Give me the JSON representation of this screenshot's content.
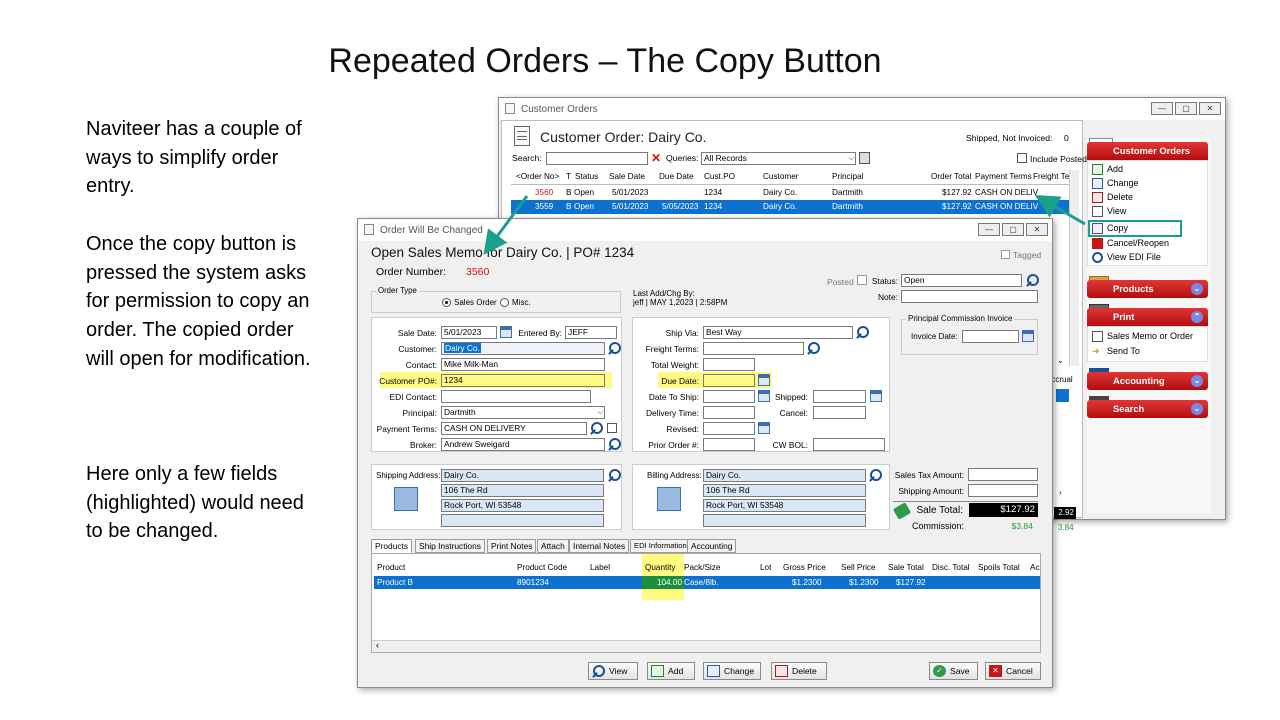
{
  "slide": {
    "title": "Repeated Orders – The Copy Button",
    "paragraphs": [
      "Naviteer has a couple of ways to simplify order entry.",
      "Once the copy button is pressed the system asks for permission to copy an order.  The copied order will open for modification.",
      "Here only a few fields (highlighted) would need to be changed."
    ]
  },
  "colors": {
    "accent_red": "#c81616",
    "selection_blue": "#0e71d0",
    "highlight_yellow": "#fffa82",
    "callout_green": "#1a9f8b"
  },
  "back_window": {
    "title": "Customer Orders",
    "heading": "Customer Order: Dairy Co.",
    "shipped_label": "Shipped, Not Invoiced:",
    "shipped_value": "0",
    "search_label": "Search:",
    "queries_label": "Queries:",
    "queries_value": "All Records",
    "include_posted": "Include Posted",
    "columns": [
      "<Order No>",
      "T",
      "Status",
      "Sale Date",
      "Due Date",
      "Cust.PO",
      "Customer",
      "Principal",
      "Order Total",
      "Payment Terms",
      "Freight Te"
    ],
    "rows": [
      [
        "3560",
        "B",
        "Open",
        "5/01/2023",
        "",
        "1234",
        "Dairy Co.",
        "Dartmith",
        "$127.92",
        "CASH ON DELIV",
        ""
      ],
      [
        "3559",
        "B",
        "Open",
        "5/01/2023",
        "5/05/2023",
        "1234",
        "Dairy Co.",
        "Dartmith",
        "$127.92",
        "CASH ON DELIV",
        ""
      ]
    ],
    "partial_accrual": "Accrual",
    "partial_total": "2.92",
    "partial_commission": "3.84"
  },
  "sidebar": {
    "customer_orders": "Customer Orders",
    "items": [
      "Add",
      "Change",
      "Delete",
      "View",
      "Copy",
      "Cancel/Reopen",
      "View EDI File"
    ],
    "products": "Products",
    "print": "Print",
    "print_items": [
      "Sales Memo or Order",
      "Send To"
    ],
    "accounting": "Accounting",
    "search": "Search"
  },
  "dialog": {
    "title": "Order Will Be Changed",
    "heading": "Open Sales Memo for Dairy Co. | PO# 1234",
    "tagged": "Tagged",
    "order_number_label": "Order Number:",
    "order_number": "3560",
    "order_type_label": "Order Type",
    "sales_order": "Sales Order",
    "misc": "Misc.",
    "last_add_label": "Last Add/Chg By:",
    "last_add_value": "jeff | MAY  1,2023 |  2:58PM",
    "posted": "Posted",
    "status_label": "Status:",
    "status_value": "Open",
    "note_label": "Note:",
    "sale_date_label": "Sale Date:",
    "sale_date": "5/01/2023",
    "entered_by_label": "Entered By:",
    "entered_by": "JEFF",
    "customer_label": "Customer:",
    "customer": "Dairy Co.",
    "contact_label": "Contact:",
    "contact": "Mike Milk-Man",
    "customer_po_label": "Customer PO#:",
    "customer_po": "1234",
    "edi_contact_label": "EDI Contact:",
    "principal_label": "Principal:",
    "principal": "Dartmith",
    "payment_terms_label": "Payment Terms:",
    "payment_terms": "CASH ON DELIVERY",
    "broker_label": "Broker:",
    "broker": "Andrew Sweigard",
    "ship_via_label": "Ship Via:",
    "ship_via": "Best Way",
    "freight_terms_label": "Freight Terms:",
    "total_weight_label": "Total Weight:",
    "due_date_label": "Due Date:",
    "date_to_ship_label": "Date To Ship:",
    "shipped_label": "Shipped:",
    "delivery_time_label": "Delivery Time:",
    "cancel_label": "Cancel:",
    "revised_label": "Revised:",
    "prior_order_label": "Prior Order #:",
    "cw_bol_label": "CW BOL:",
    "principal_commission": "Principal Commission Invoice",
    "invoice_date_label": "Invoice Date:",
    "shipping_address_label": "Shipping Address:",
    "shipping_address": [
      "Dairy Co.",
      "106 The Rd",
      "Rock Port, WI 53548",
      ""
    ],
    "billing_address_label": "Billing Address:",
    "billing_address": [
      "Dairy Co.",
      "106 The Rd",
      "Rock Port, WI 53548",
      ""
    ],
    "sales_tax_label": "Sales Tax Amount:",
    "shipping_amount_label": "Shipping Amount:",
    "sale_total_label": "Sale Total:",
    "sale_total": "$127.92",
    "commission_label": "Commission:",
    "commission": "$3.84",
    "tabs": [
      "Products",
      "Ship Instructions",
      "Print Notes",
      "Attach",
      "Internal Notes",
      "EDI Information",
      "Accounting"
    ],
    "grid_columns": [
      "Product",
      "Product Code",
      "Label",
      "Quantity",
      "Pack/Size",
      "Lot",
      "Gross Price",
      "Sell Price",
      "Sale Total",
      "Disc. Total",
      "Spoils Total",
      "Ac"
    ],
    "grid_row": [
      "Product B",
      "8901234",
      "",
      "104.00",
      "Case/8lb.",
      "",
      "$1.2300",
      "$1.2300",
      "$127.92",
      "",
      "",
      ""
    ],
    "buttons": {
      "view": "View",
      "add": "Add",
      "change": "Change",
      "delete": "Delete",
      "save": "Save",
      "cancel": "Cancel"
    }
  }
}
